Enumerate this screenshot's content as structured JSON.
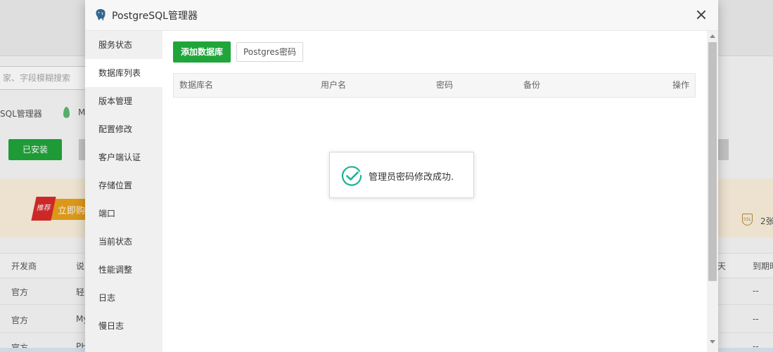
{
  "background": {
    "search_placeholder": "家、字段模糊搜索",
    "app_name": "SQL管理器",
    "app_name_2": "M",
    "installed_label": "已安装",
    "promo_tag": "推荐",
    "promo_label": "立即购",
    "promo_right": "2张",
    "table_headers": [
      "开发商",
      "说",
      "天",
      "到期时"
    ],
    "rows": [
      {
        "vendor": "官方",
        "desc": "轻",
        "expiry": "--"
      },
      {
        "vendor": "官方",
        "desc": "My",
        "expiry": "--"
      },
      {
        "vendor": "官方",
        "desc": "PH",
        "expiry": "--"
      }
    ]
  },
  "dialog": {
    "title": "PostgreSQL管理器",
    "nav": [
      {
        "label": "服务状态",
        "active": false
      },
      {
        "label": "数据库列表",
        "active": true
      },
      {
        "label": "版本管理",
        "active": false
      },
      {
        "label": "配置修改",
        "active": false
      },
      {
        "label": "客户端认证",
        "active": false
      },
      {
        "label": "存储位置",
        "active": false
      },
      {
        "label": "端口",
        "active": false
      },
      {
        "label": "当前状态",
        "active": false
      },
      {
        "label": "性能调整",
        "active": false
      },
      {
        "label": "日志",
        "active": false
      },
      {
        "label": "慢日志",
        "active": false
      }
    ],
    "toolbar": {
      "add_label": "添加数据库",
      "password_label": "Postgres密码"
    },
    "table": {
      "columns": [
        "数据库名",
        "用户名",
        "密码",
        "备份",
        "操作"
      ]
    },
    "toast": {
      "message": "管理员密码修改成功."
    }
  },
  "colors": {
    "primary_green": "#20a53a",
    "success_teal": "#1bb394"
  }
}
